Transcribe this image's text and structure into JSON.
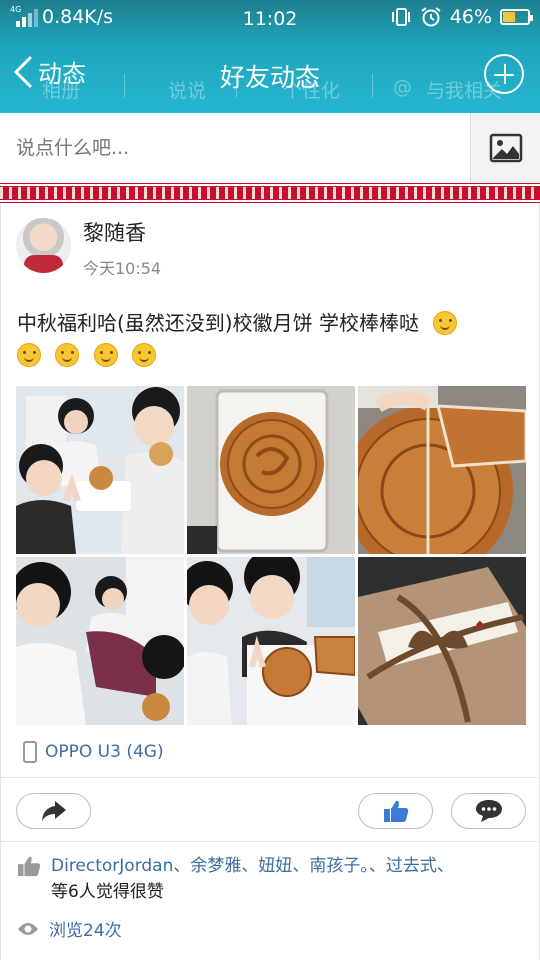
{
  "status_bar": {
    "network_type": "4G",
    "speed": "0.84K/s",
    "time": "11:02",
    "battery_percent": "46%",
    "battery_level": 0.46
  },
  "header": {
    "back_label": "动态",
    "title": "好友动态",
    "ghost_tabs": [
      "相册",
      "说说",
      "个性化",
      "@",
      "与我相关"
    ]
  },
  "compose": {
    "placeholder": "说点什么吧..."
  },
  "post": {
    "author": "黎随香",
    "time": "今天10:54",
    "text": "中秋福利哈(虽然还没到)校徽月饼 学校棒棒哒",
    "emoji_count": 5,
    "photo_count": 6,
    "device": "OPPO U3 (4G)",
    "likes_names": "DirectorJordan、余梦雅、妞妞、南孩子。、过去式、",
    "likes_tail": "等6人觉得很赞",
    "views": "浏览24次"
  },
  "colors": {
    "header_teal": "#1fa5bd",
    "link_blue": "#3a6ea5",
    "deco_red": "#c8102e",
    "like_blue": "#3a7bd5"
  }
}
